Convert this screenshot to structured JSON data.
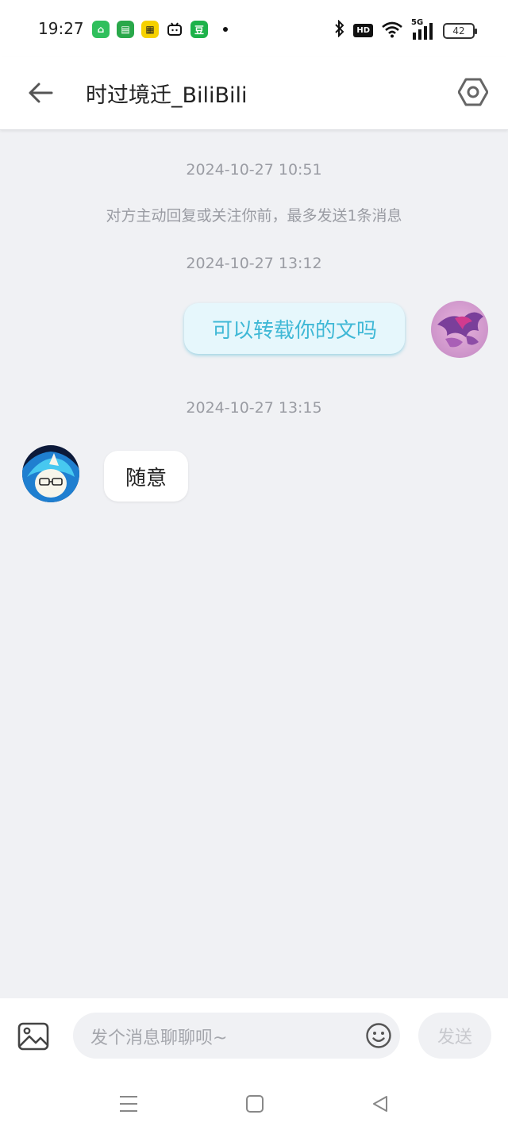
{
  "status_bar": {
    "time": "19:27",
    "apps": [
      "tmall-icon",
      "chat-icon",
      "clipboard-icon",
      "bilibili-icon",
      "douban-icon"
    ],
    "douban_glyph": "豆",
    "hd_label": "HD",
    "signal_label": "5G",
    "battery": "42"
  },
  "header": {
    "title": "时过境迁_BiliBili"
  },
  "messages": [
    {
      "type": "timestamp",
      "text": "2024-10-27 10:51"
    },
    {
      "type": "notice",
      "text": "对方主动回复或关注你前，最多发送1条消息"
    },
    {
      "type": "timestamp",
      "text": "2024-10-27 13:12"
    },
    {
      "type": "outgoing",
      "text": "可以转载你的文吗"
    },
    {
      "type": "timestamp",
      "text": "2024-10-27 13:15"
    },
    {
      "type": "incoming",
      "text": "随意"
    }
  ],
  "input": {
    "placeholder": "发个消息聊聊呗~",
    "send_label": "发送"
  },
  "colors": {
    "background": "#f0f1f4",
    "outgoing_bubble": "#e6f7fc",
    "outgoing_text": "#3fb8d6",
    "muted_text": "#9a9ca3"
  }
}
